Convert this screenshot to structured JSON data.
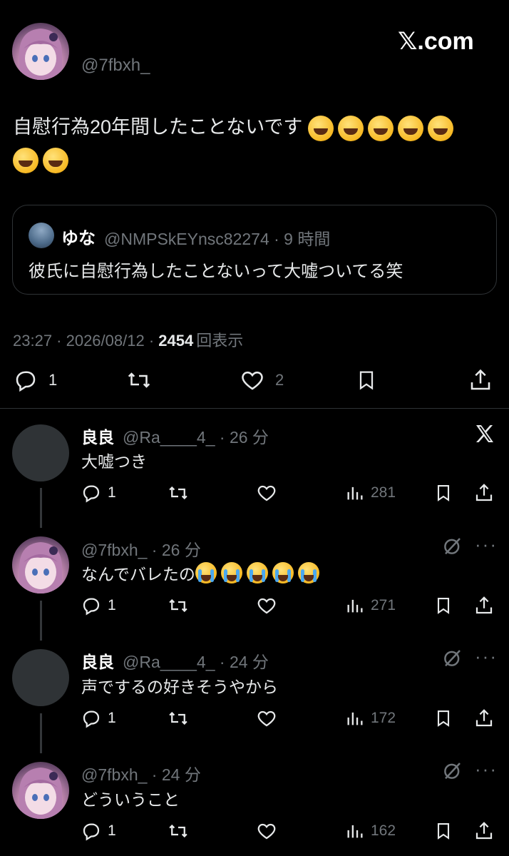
{
  "main_tweet": {
    "handle": "@7fbxh_",
    "brand": "𝕏.com",
    "text": "自慰行為20年間したことないです",
    "quote": {
      "name": "ゆな",
      "handle_time": "@NMPSkEYnsc82274 · 9 時間",
      "text": "彼氏に自慰行為したことないって大嘘ついてる笑"
    },
    "meta_prefix": "23:27 · 2026/08/12 · ",
    "views_count": "2454",
    "views_label": "回表示",
    "reply_count": "1",
    "like_count": "2"
  },
  "replies": [
    {
      "name": "良良",
      "handle_time": "@Ra____4_ · 26 分",
      "text": "大嘘つき",
      "reply_count": "1",
      "views": "281"
    },
    {
      "name": "",
      "handle_time": "@7fbxh_ · 26 分",
      "text": "なんでバレたの",
      "reply_count": "1",
      "views": "271"
    },
    {
      "name": "良良",
      "handle_time": "@Ra____4_ · 24 分",
      "text": "声でするの好きそうやから",
      "reply_count": "1",
      "views": "172"
    },
    {
      "name": "",
      "handle_time": "@7fbxh_ · 24 分",
      "text": "どういうこと",
      "reply_count": "1",
      "views": "162"
    }
  ],
  "icons": {
    "reply": "reply-icon",
    "retweet": "retweet-icon",
    "like": "heart-icon",
    "bookmark": "bookmark-icon",
    "share": "share-icon",
    "views": "bar-chart-icon",
    "more": "more-icon",
    "grok": "grok-icon",
    "x_logo": "x-logo-icon"
  }
}
